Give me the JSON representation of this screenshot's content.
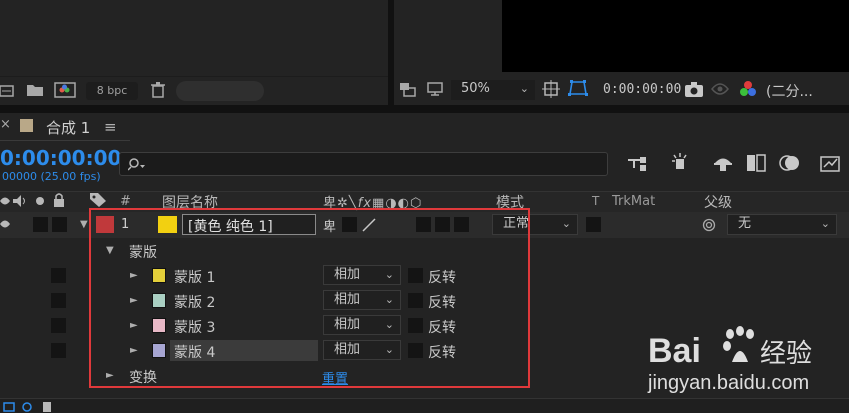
{
  "project_panel": {
    "bpc": "8 bpc"
  },
  "viewer": {
    "zoom": "50%",
    "timecode": "0:00:00:00",
    "resolution": "(二分..."
  },
  "timeline": {
    "tab_title": "合成 1",
    "current_time": "0:00:00:00",
    "frame_info": "00000 (25.00 fps)"
  },
  "headers": {
    "hash": "#",
    "layer_name": "图层名称",
    "mode": "模式",
    "t": "T",
    "trkmat": "TrkMat",
    "parent": "父级"
  },
  "layer": {
    "number": "1",
    "name": "[黄色 纯色 1]",
    "mode": "正常",
    "parent": "无",
    "color_label": "#c0393b",
    "swatch_color": "#f2d011"
  },
  "masks_group": {
    "label": "蒙版"
  },
  "masks": [
    {
      "name": "蒙版 1",
      "color": "#e3cf3a",
      "mode": "相加",
      "invert_label": "反转"
    },
    {
      "name": "蒙版 2",
      "color": "#a9cfc2",
      "mode": "相加",
      "invert_label": "反转"
    },
    {
      "name": "蒙版 3",
      "color": "#e8b9c7",
      "mode": "相加",
      "invert_label": "反转"
    },
    {
      "name": "蒙版 4",
      "color": "#a6a5d2",
      "mode": "相加",
      "invert_label": "反转"
    }
  ],
  "transform": {
    "label": "变换",
    "reset": "重置"
  },
  "watermark": {
    "brand": "Baidu 经验",
    "url": "jingyan.baidu.com"
  },
  "colors": {
    "accent_blue": "#2d8ceb",
    "highlight_red": "#e0393b"
  }
}
